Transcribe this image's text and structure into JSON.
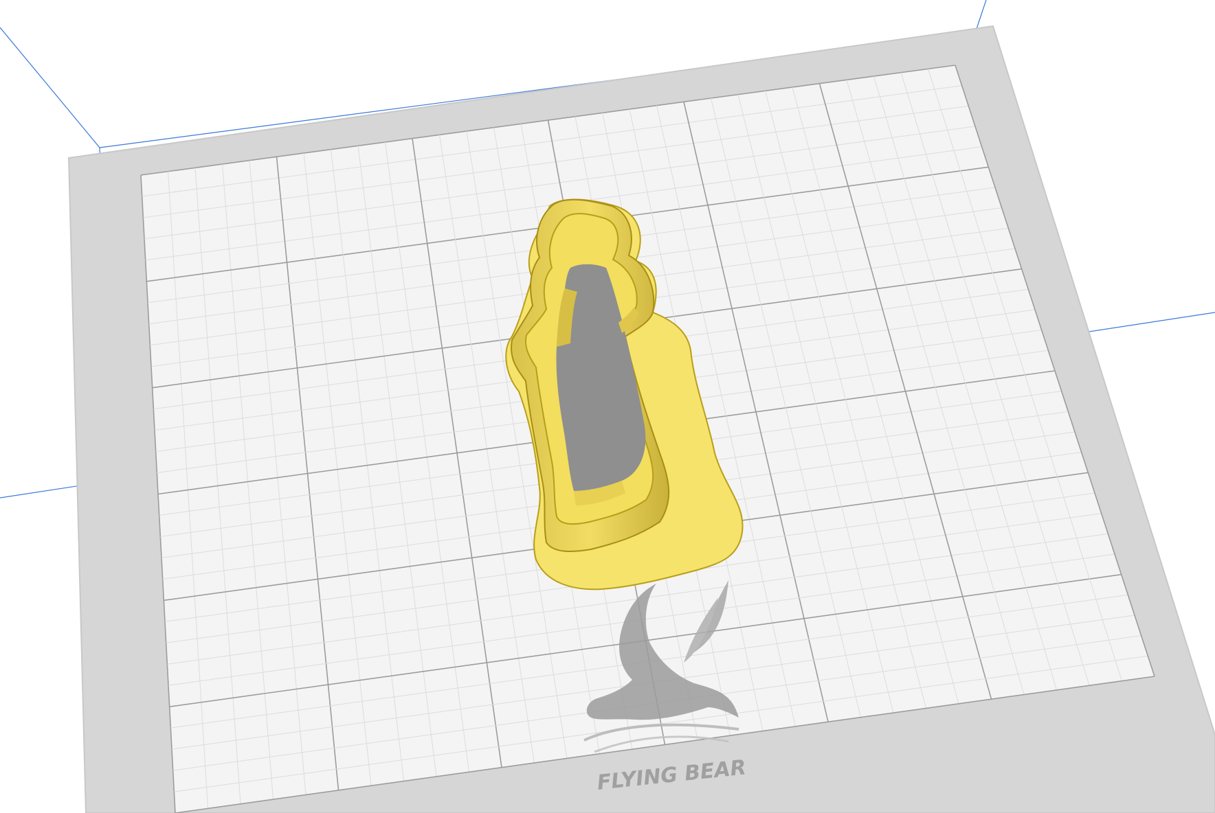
{
  "viewport": {
    "background": "#ffffff",
    "bed_color": "#d9d9d9",
    "bed_inner_color": "#f5f5f5",
    "grid_minor_color": "#dcdcdc",
    "grid_major_color": "#9c9c9c",
    "axis_line_color": "#3a78d8",
    "model_color": "#f6e36b",
    "model_edge_color": "#b89e1a",
    "model_shadow_color": "#a8a8a8"
  },
  "bed_logo": {
    "icon": "flying-bear-icon",
    "text": "FLYING BEAR"
  },
  "model": {
    "icon": "cookie-cutter-model"
  }
}
